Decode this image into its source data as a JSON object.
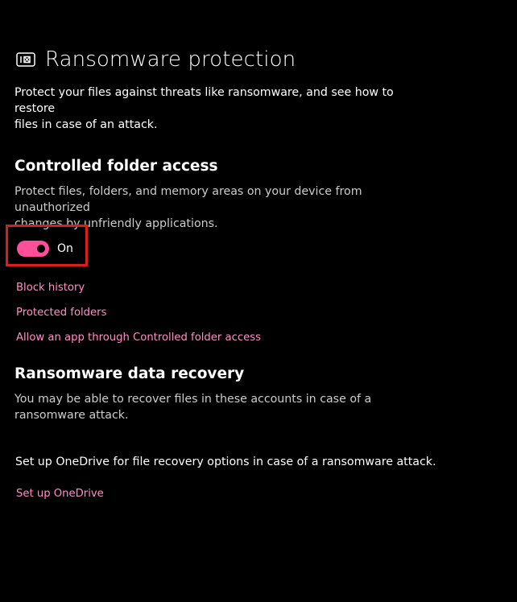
{
  "header": {
    "title": "Ransomware protection",
    "icon": "ransomware-protection-icon"
  },
  "intro": {
    "text_line1": "Protect your files against threats like ransomware, and see how to restore",
    "text_line2": "files in case of an attack."
  },
  "controlled_folder_access": {
    "title": "Controlled folder access",
    "desc_line1": "Protect files, folders, and memory areas on your device from unauthorized",
    "desc_line2": "changes by unfriendly applications.",
    "toggle": {
      "state": "On",
      "checked": true,
      "accent": "#ff4f9a"
    },
    "links": {
      "block_history": "Block history",
      "protected_folders": "Protected folders",
      "allow_app": "Allow an app through Controlled folder access"
    }
  },
  "recovery": {
    "title": "Ransomware data recovery",
    "desc_line1": "You may be able to recover files in these accounts in case of a",
    "desc_line2": "ransomware attack.",
    "onedrive_text": "Set up OneDrive for file recovery options in case of a ransomware attack.",
    "onedrive_link": "Set up OneDrive"
  },
  "colors": {
    "background": "#000000",
    "link": "#ff8fc8",
    "highlight_border": "#d81e1e"
  }
}
